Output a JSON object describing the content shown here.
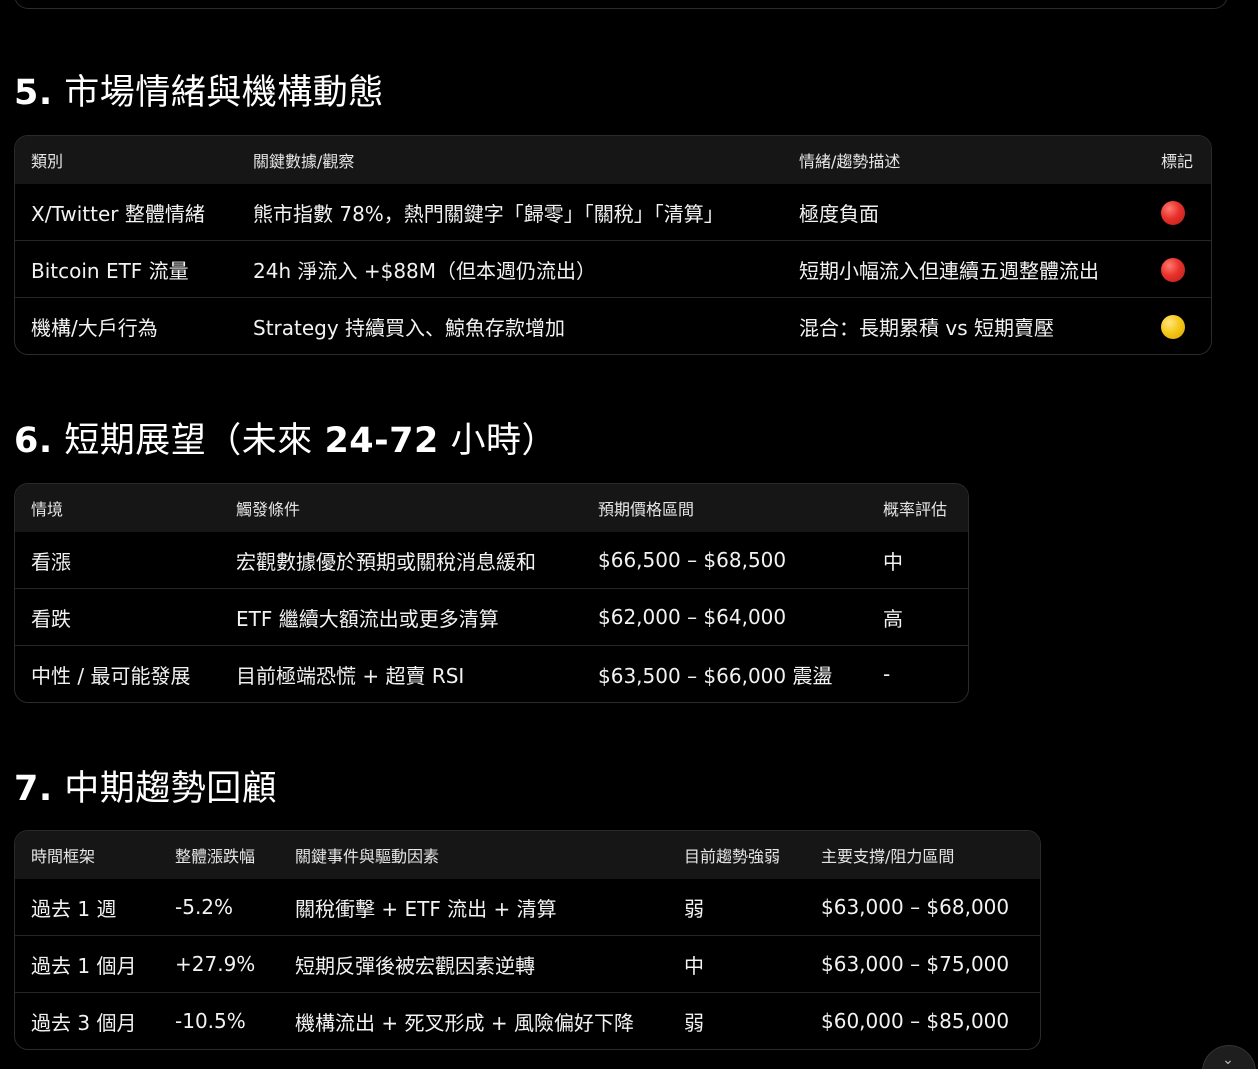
{
  "colors": {
    "background": "#000000",
    "table_header_bg": "#161616",
    "border": "#2b2b2b",
    "red_marker": "#e8312b",
    "yellow_marker": "#f5c81a"
  },
  "section5": {
    "number": "5.",
    "title": "市場情緒與機構動態",
    "headers": [
      "類別",
      "關鍵數據/觀察",
      "情緒/趨勢描述",
      "標記"
    ],
    "rows": [
      {
        "category": "X/Twitter 整體情緒",
        "data": "熊市指數 78%，熱門關鍵字「歸零」「關稅」「清算」",
        "sentiment": "極度負面",
        "marker": "red"
      },
      {
        "category": "Bitcoin ETF 流量",
        "data": "24h 淨流入 +$88M（但本週仍流出）",
        "sentiment": "短期小幅流入但連續五週整體流出",
        "marker": "red"
      },
      {
        "category": "機構/大戶行為",
        "data": "Strategy 持續買入、鯨魚存款增加",
        "sentiment": "混合：長期累積 vs 短期賣壓",
        "marker": "yellow"
      }
    ]
  },
  "section6": {
    "number": "6.",
    "title": "短期展望（未來 ",
    "title_range": "24-72",
    "title_suffix": " 小時）",
    "headers": [
      "情境",
      "觸發條件",
      "預期價格區間",
      "概率評估"
    ],
    "rows": [
      {
        "scenario": "看漲",
        "trigger": "宏觀數據優於預期或關稅消息緩和",
        "range": "$66,500 – $68,500",
        "prob": "中"
      },
      {
        "scenario": "看跌",
        "trigger": "ETF 繼續大額流出或更多清算",
        "range": "$62,000 – $64,000",
        "prob": "高"
      },
      {
        "scenario": "中性 / 最可能發展",
        "trigger": "目前極端恐慌 + 超賣 RSI",
        "range": "$63,500 – $66,000 震盪",
        "prob": "-"
      }
    ]
  },
  "section7": {
    "number": "7.",
    "title": "中期趨勢回顧",
    "headers": [
      "時間框架",
      "整體漲跌幅",
      "關鍵事件與驅動因素",
      "目前趨勢強弱",
      "主要支撐/阻力區間"
    ],
    "rows": [
      {
        "timeframe": "過去 1 週",
        "change": "-5.2%",
        "drivers": "關稅衝擊 + ETF 流出 + 清算",
        "strength": "弱",
        "levels": "$63,000 – $68,000"
      },
      {
        "timeframe": "過去 1 個月",
        "change": "+27.9%",
        "drivers": "短期反彈後被宏觀因素逆轉",
        "strength": "中",
        "levels": "$63,000 – $75,000"
      },
      {
        "timeframe": "過去 3 個月",
        "change": "-10.5%",
        "drivers": "機構流出 + 死叉形成 + 風險偏好下降",
        "strength": "弱",
        "levels": "$60,000 – $85,000"
      }
    ]
  },
  "scroll_button": {
    "glyph": "⌄"
  }
}
